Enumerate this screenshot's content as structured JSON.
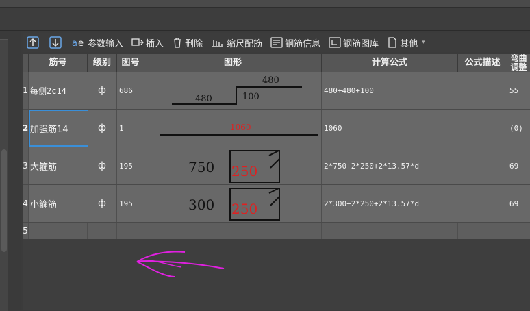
{
  "toolbar": {
    "insert_above": "",
    "insert_below": "",
    "param_input": "参数输入",
    "insert": "插入",
    "delete": "删除",
    "scale_rebar": "缩尺配筋",
    "rebar_info": "钢筋信息",
    "rebar_library": "钢筋图库",
    "more": "其他"
  },
  "table": {
    "headers": {
      "name": "筋号",
      "grade": "级别",
      "fig_no": "图号",
      "shape": "图形",
      "formula": "计算公式",
      "formula_desc": "公式描述",
      "bend": "弯曲调整"
    },
    "rows": [
      {
        "index": "1",
        "name": "每侧2c14",
        "grade": "ф",
        "fig_no": "686",
        "formula": "480+480+100",
        "formula_desc": "",
        "bend": "55",
        "shape": {
          "top": "480",
          "left": "480",
          "right": "100"
        }
      },
      {
        "index": "2",
        "name": "加强筋14",
        "grade": "ф",
        "fig_no": "1",
        "formula": "1060",
        "formula_desc": "",
        "bend": "(0)",
        "shape": {
          "length": "1060"
        }
      },
      {
        "index": "3",
        "name": "大箍筋",
        "grade": "ф",
        "fig_no": "195",
        "formula": "2*750+2*250+2*13.57*d",
        "formula_desc": "",
        "bend": "69",
        "shape": {
          "width": "750",
          "height": "250"
        }
      },
      {
        "index": "4",
        "name": "小箍筋",
        "grade": "ф",
        "fig_no": "195",
        "formula": "2*300+2*250+2*13.57*d",
        "formula_desc": "",
        "bend": "69",
        "shape": {
          "width": "300",
          "height": "250"
        }
      },
      {
        "index": "5",
        "name": "",
        "grade": "",
        "fig_no": "",
        "formula": "",
        "formula_desc": "",
        "bend": ""
      }
    ]
  },
  "colors": {
    "shape_line": "#111111",
    "highlight_text": "#e02020",
    "selection": "#3a8fd8",
    "annotation": "#e020e0"
  }
}
